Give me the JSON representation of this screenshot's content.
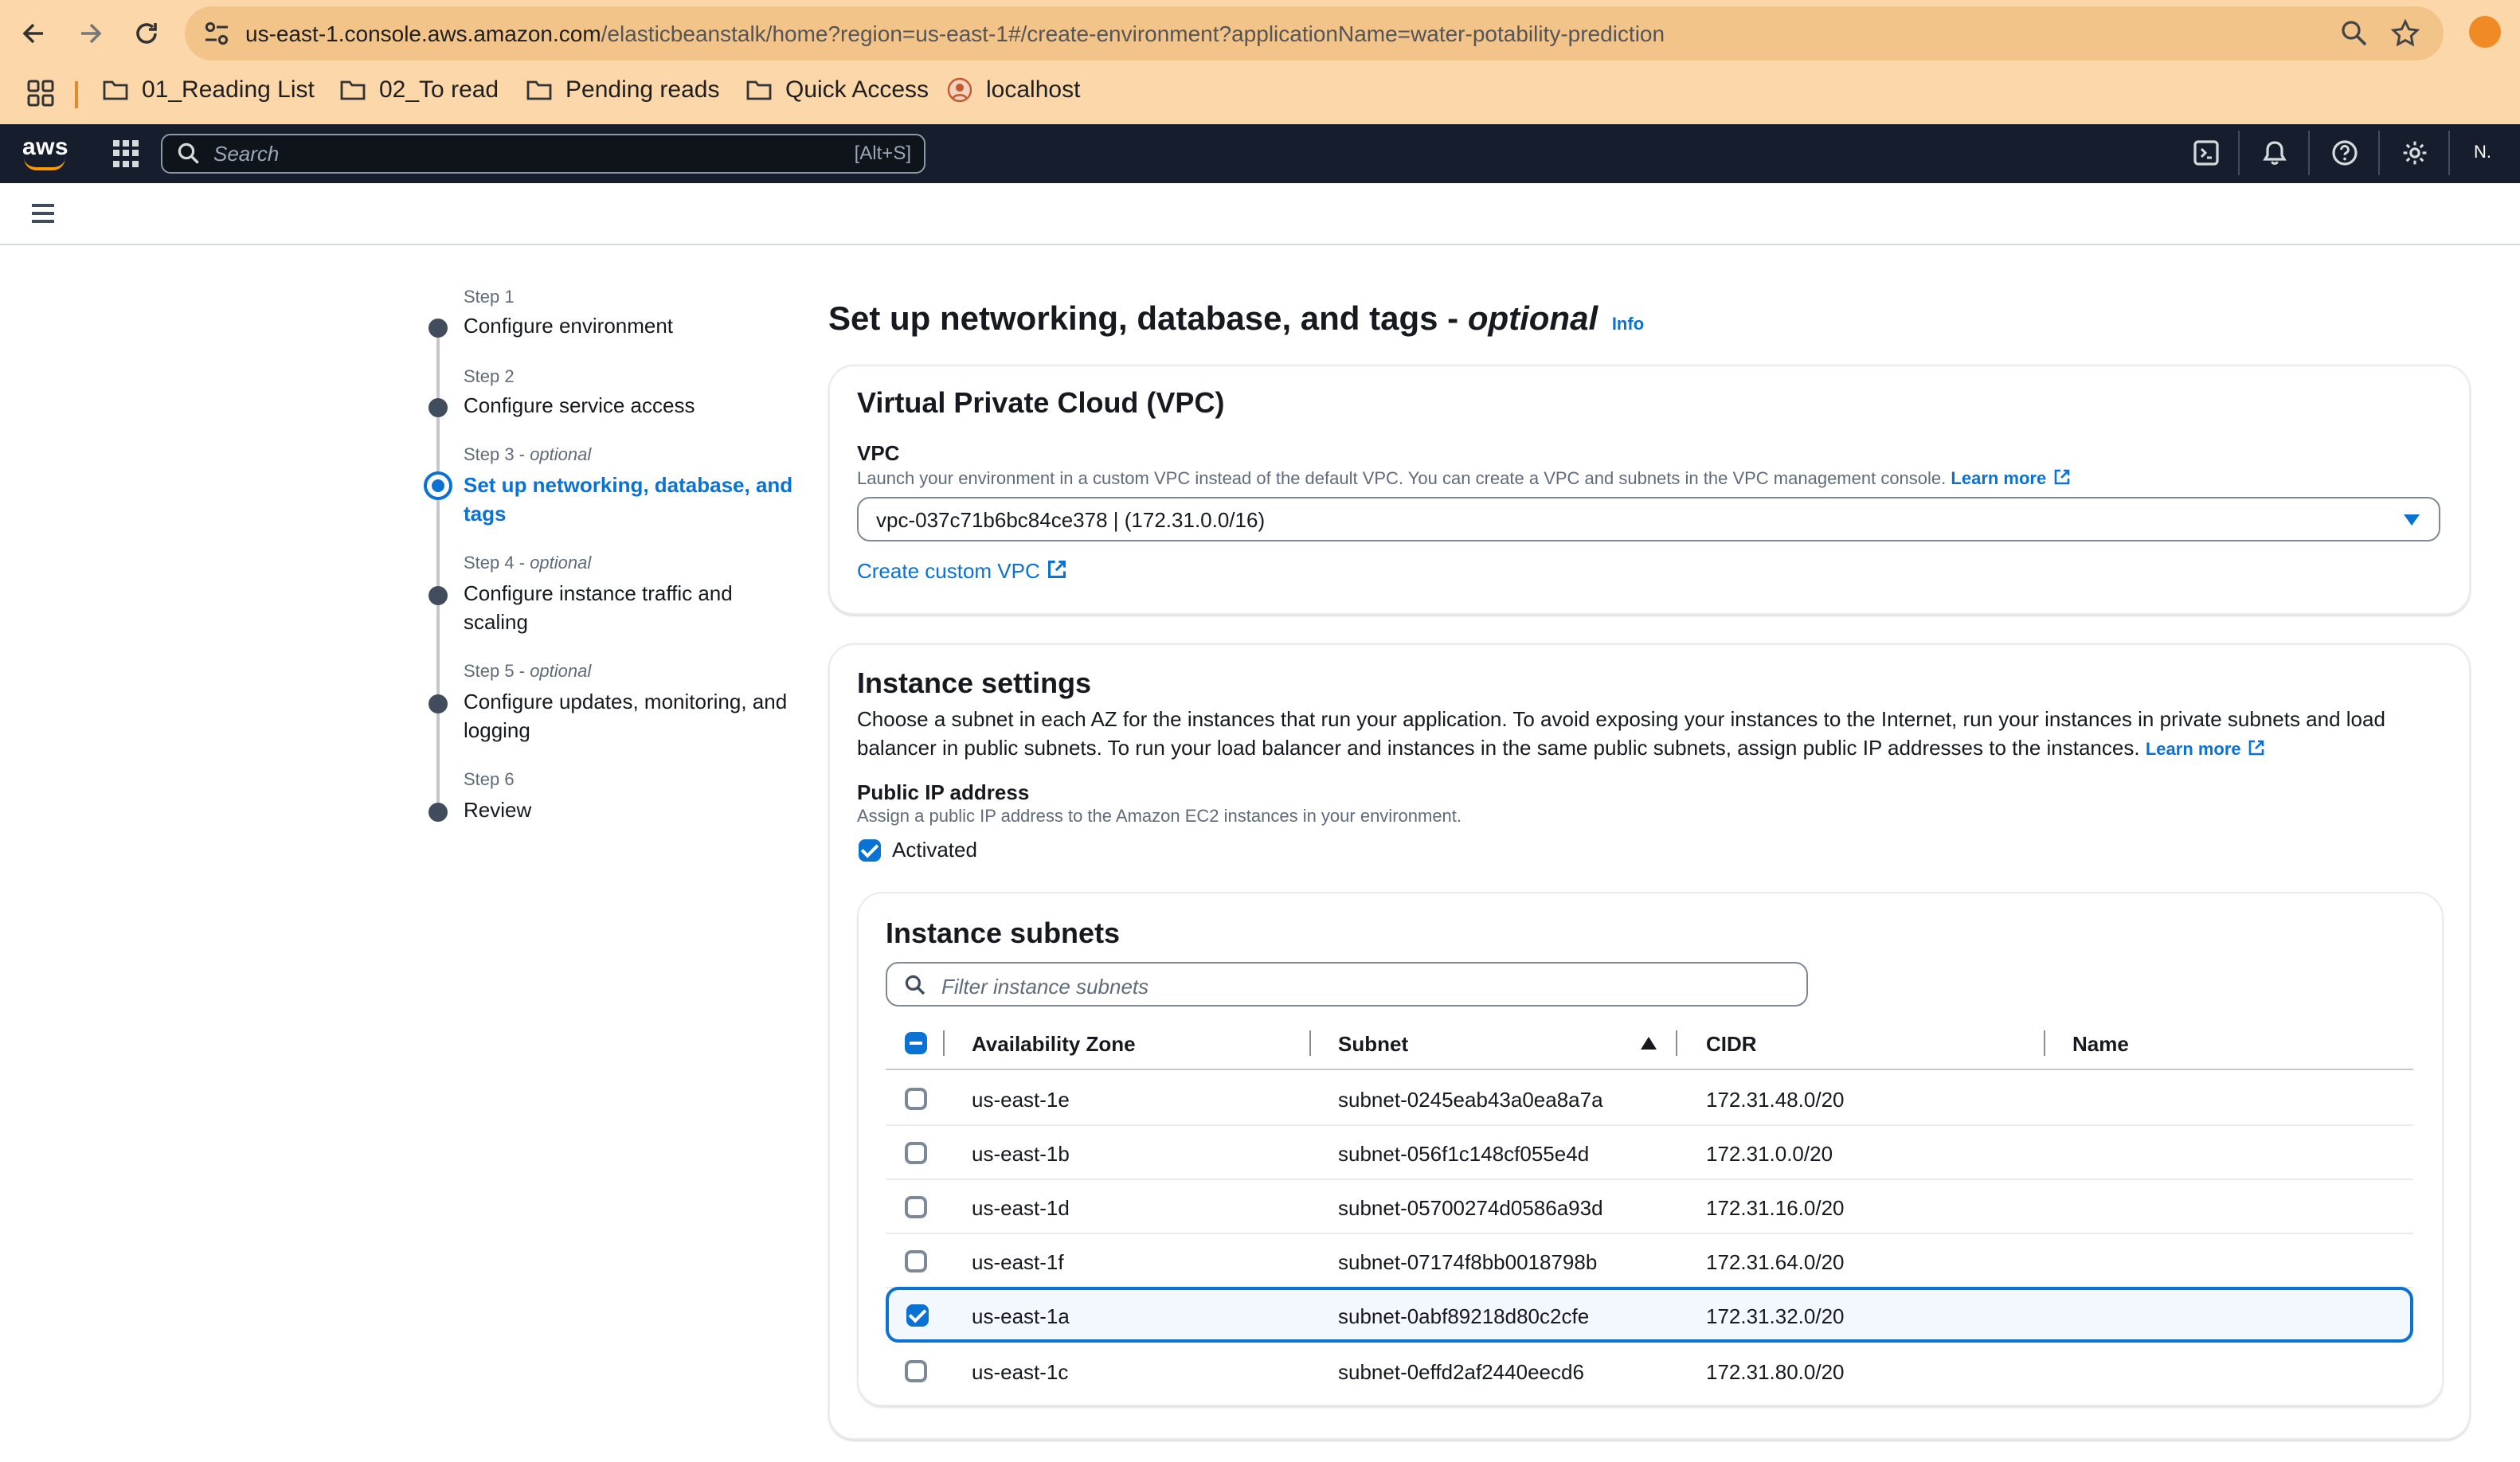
{
  "browser": {
    "url_host": "us-east-1.console.aws.amazon.com",
    "url_path": "/elasticbeanstalk/home?region=us-east-1#/create-environment?applicationName=water-potability-prediction",
    "bookmarks": [
      {
        "label": "01_Reading List",
        "icon": "folder-icon"
      },
      {
        "label": "02_To read",
        "icon": "folder-icon"
      },
      {
        "label": "Pending reads",
        "icon": "folder-icon"
      },
      {
        "label": "Quick Access",
        "icon": "folder-icon"
      },
      {
        "label": "localhost",
        "icon": "site-favicon"
      }
    ]
  },
  "aws_header": {
    "logo": "aws",
    "search_placeholder": "Search",
    "search_shortcut": "[Alt+S]",
    "user": "N."
  },
  "steps": [
    {
      "number": "Step 1",
      "optional": "",
      "title": "Configure environment",
      "state": "complete"
    },
    {
      "number": "Step 2",
      "optional": "",
      "title": "Configure service access",
      "state": "complete"
    },
    {
      "number": "Step 3",
      "optional": "optional",
      "title": "Set up networking, database, and tags",
      "state": "active"
    },
    {
      "number": "Step 4",
      "optional": "optional",
      "title": "Configure instance traffic and scaling",
      "state": "pending"
    },
    {
      "number": "Step 5",
      "optional": "optional",
      "title": "Configure updates, monitoring, and logging",
      "state": "pending"
    },
    {
      "number": "Step 6",
      "optional": "",
      "title": "Review",
      "state": "pending"
    }
  ],
  "page": {
    "title": "Set up networking, database, and tags - ",
    "title_optional": "optional",
    "info": "Info"
  },
  "vpc": {
    "heading": "Virtual Private Cloud (VPC)",
    "label": "VPC",
    "description": "Launch your environment in a custom VPC instead of the default VPC. You can create a VPC and subnets in the VPC management console.",
    "learn_more": "Learn more",
    "selected": "vpc-037c71b6bc84ce378 | (172.31.0.0/16)",
    "create_link": "Create custom VPC"
  },
  "instance_settings": {
    "heading": "Instance settings",
    "description": "Choose a subnet in each AZ for the instances that run your application. To avoid exposing your instances to the Internet, run your instances in private subnets and load balancer in public subnets. To run your load balancer and instances in the same public subnets, assign public IP addresses to the instances.",
    "learn_more": "Learn more",
    "public_ip_label": "Public IP address",
    "public_ip_description": "Assign a public IP address to the Amazon EC2 instances in your environment.",
    "public_ip_checkbox": "Activated",
    "public_ip_checked": true
  },
  "subnets": {
    "heading": "Instance subnets",
    "filter_placeholder": "Filter instance subnets",
    "columns": [
      "Availability Zone",
      "Subnet",
      "CIDR",
      "Name"
    ],
    "sort_column": "Subnet",
    "rows": [
      {
        "az": "us-east-1e",
        "subnet": "subnet-0245eab43a0ea8a7a",
        "cidr": "172.31.48.0/20",
        "name": "",
        "selected": false
      },
      {
        "az": "us-east-1b",
        "subnet": "subnet-056f1c148cf055e4d",
        "cidr": "172.31.0.0/20",
        "name": "",
        "selected": false
      },
      {
        "az": "us-east-1d",
        "subnet": "subnet-05700274d0586a93d",
        "cidr": "172.31.16.0/20",
        "name": "",
        "selected": false
      },
      {
        "az": "us-east-1f",
        "subnet": "subnet-07174f8bb0018798b",
        "cidr": "172.31.64.0/20",
        "name": "",
        "selected": false
      },
      {
        "az": "us-east-1a",
        "subnet": "subnet-0abf89218d80c2cfe",
        "cidr": "172.31.32.0/20",
        "name": "",
        "selected": true
      },
      {
        "az": "us-east-1c",
        "subnet": "subnet-0effd2af2440eecd6",
        "cidr": "172.31.80.0/20",
        "name": "",
        "selected": false
      }
    ]
  },
  "colors": {
    "chrome": "#fbd7aa",
    "aws_header": "#161e2d",
    "accent": "#0972d3",
    "aws_orange": "#ff9900"
  }
}
